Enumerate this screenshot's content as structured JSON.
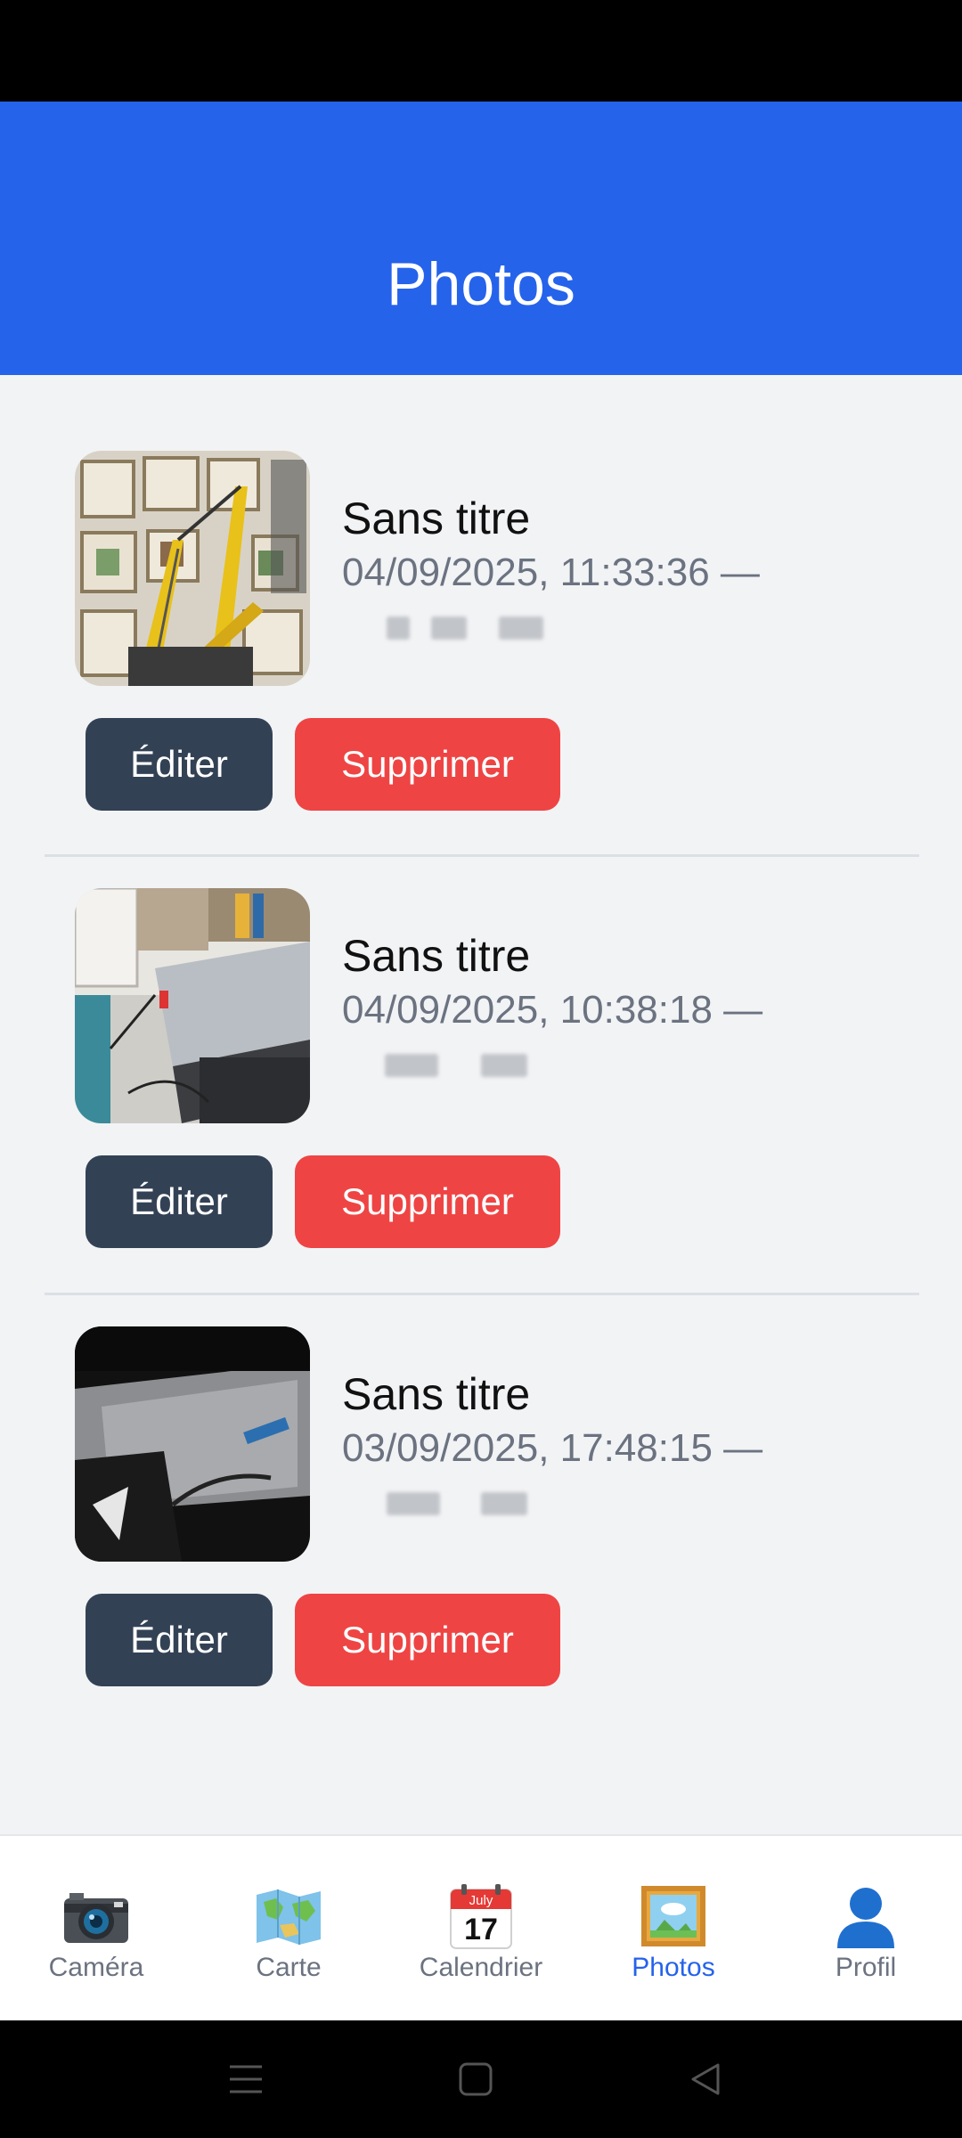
{
  "header": {
    "title": "Photos"
  },
  "photos": [
    {
      "title": "Sans titre",
      "meta": "04/09/2025, 11:33:36 —",
      "edit_label": "Éditer",
      "delete_label": "Supprimer"
    },
    {
      "title": "Sans titre",
      "meta": "04/09/2025, 10:38:18 —",
      "edit_label": "Éditer",
      "delete_label": "Supprimer"
    },
    {
      "title": "Sans titre",
      "meta": "03/09/2025, 17:48:15 —",
      "edit_label": "Éditer",
      "delete_label": "Supprimer"
    }
  ],
  "tabs": [
    {
      "label": "Caméra",
      "icon": "camera-icon"
    },
    {
      "label": "Carte",
      "icon": "map-icon"
    },
    {
      "label": "Calendrier",
      "icon": "calendar-icon",
      "calendar_month": "July",
      "calendar_day": "17"
    },
    {
      "label": "Photos",
      "icon": "framed-picture-icon",
      "active": true
    },
    {
      "label": "Profil",
      "icon": "profile-icon"
    }
  ],
  "colors": {
    "header": "#2563eb",
    "edit_button": "#334155",
    "delete_button": "#ef4444",
    "active_tab": "#2563eb",
    "inactive_tab": "#6b7280"
  }
}
